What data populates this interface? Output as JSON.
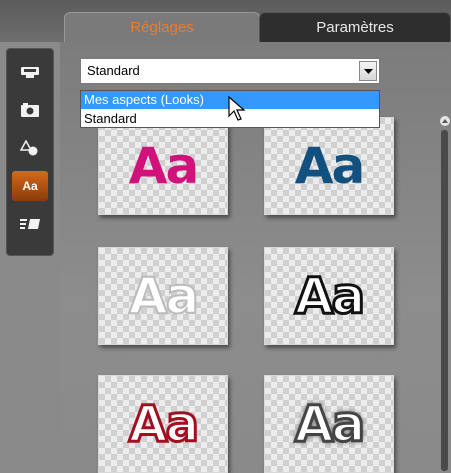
{
  "tabs": [
    {
      "label": "Réglages",
      "active": true
    },
    {
      "label": "Paramètres",
      "active": false
    }
  ],
  "colors": {
    "active_tab_text": "#f07a2a",
    "selection_highlight": "#3399ff",
    "tool_active": "#d46a1a"
  },
  "toolbar": {
    "items": [
      {
        "icon": "video-track-icon"
      },
      {
        "icon": "photo-icon"
      },
      {
        "icon": "shapes-icon"
      },
      {
        "icon": "text-style-icon",
        "label": "Aa",
        "active": true
      },
      {
        "icon": "text-align-icon"
      }
    ]
  },
  "preset_select": {
    "value": "Standard",
    "options": [
      "Mes aspects (Looks)",
      "Standard"
    ],
    "highlighted": "Mes aspects (Looks)"
  },
  "looks": [
    {
      "label": "Aa",
      "style": "magenta"
    },
    {
      "label": "Aa",
      "style": "dark-blue"
    },
    {
      "label": "Aa",
      "style": "white-outline-gray"
    },
    {
      "label": "Aa",
      "style": "white-outline-black"
    },
    {
      "label": "Aa",
      "style": "white-outline-red"
    },
    {
      "label": "Aa",
      "style": "white-shadow-dark"
    }
  ]
}
